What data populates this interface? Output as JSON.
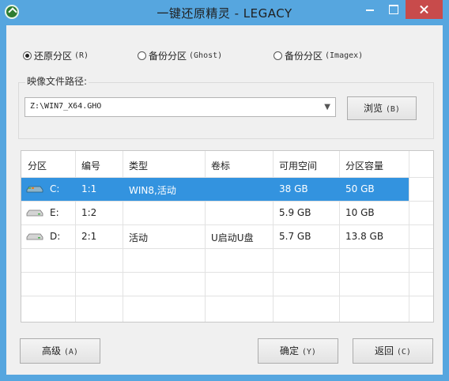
{
  "window": {
    "title": "一键还原精灵 - LEGACY"
  },
  "mode": {
    "options": [
      {
        "label": "还原分区",
        "hotkey": "(R)",
        "selected": true
      },
      {
        "label": "备份分区",
        "hotkey": "(Ghost)",
        "selected": false
      },
      {
        "label": "备份分区",
        "hotkey": "(Imagex)",
        "selected": false
      }
    ]
  },
  "image_file": {
    "label": "映像文件路径:",
    "value": "Z:\\WIN7_X64.GHO",
    "browse_label": "浏览",
    "browse_hotkey": "(B)"
  },
  "partitions": {
    "headers": [
      "分区",
      "编号",
      "类型",
      "卷标",
      "可用空间",
      "分区容量"
    ],
    "rows": [
      {
        "drive": "C:",
        "number": "1:1",
        "type": "WIN8,活动",
        "label": "",
        "free": "38 GB",
        "capacity": "50 GB",
        "selected": true,
        "icon": "system-drive-icon"
      },
      {
        "drive": "E:",
        "number": "1:2",
        "type": "",
        "label": "",
        "free": "5.9 GB",
        "capacity": "10 GB",
        "selected": false,
        "icon": "drive-icon"
      },
      {
        "drive": "D:",
        "number": "2:1",
        "type": "活动",
        "label": "U启动U盘",
        "free": "5.7 GB",
        "capacity": "13.8 GB",
        "selected": false,
        "icon": "drive-icon"
      }
    ]
  },
  "buttons": {
    "advanced_label": "高级",
    "advanced_hotkey": "(A)",
    "ok_label": "确定",
    "ok_hotkey": "(Y)",
    "back_label": "返回",
    "back_hotkey": "(C)"
  },
  "colors": {
    "selection": "#3393df",
    "titlebar": "#56a6df",
    "close": "#c84b4b"
  }
}
